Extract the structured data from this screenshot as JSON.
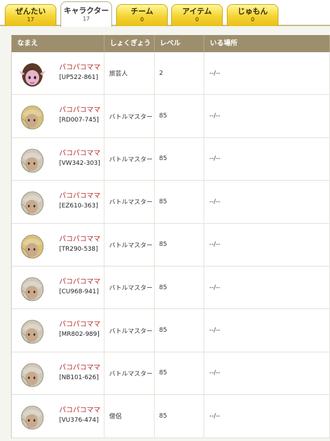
{
  "tabs": [
    {
      "label": "ぜんたい",
      "count": "17"
    },
    {
      "label": "キャラクター",
      "count": "17"
    },
    {
      "label": "チーム",
      "count": "0"
    },
    {
      "label": "アイテム",
      "count": "0"
    },
    {
      "label": "じゅもん",
      "count": "0"
    }
  ],
  "columns": {
    "name": "なまえ",
    "job": "しょくぎょう",
    "level": "レベル",
    "location": "いる場所"
  },
  "rows": [
    {
      "name": "パコパコママ",
      "id": "[UP522-861]",
      "job": "旅芸人",
      "level": "2",
      "location": "--/--",
      "avatar": "elf-dark-hair"
    },
    {
      "name": "パコパコママ",
      "id": "[RD007-745]",
      "job": "バトルマスター",
      "level": "85",
      "location": "--/--",
      "avatar": "blonde-hooded"
    },
    {
      "name": "パコパコママ",
      "id": "[VW342-303]",
      "job": "バトルマスター",
      "level": "85",
      "location": "--/--",
      "avatar": "silver-hooded"
    },
    {
      "name": "パコパコママ",
      "id": "[EZ610-363]",
      "job": "バトルマスター",
      "level": "85",
      "location": "--/--",
      "avatar": "silver-hooded"
    },
    {
      "name": "パコパコママ",
      "id": "[TR290-538]",
      "job": "バトルマスター",
      "level": "85",
      "location": "--/--",
      "avatar": "blonde-hooded"
    },
    {
      "name": "パコパコママ",
      "id": "[CU968-941]",
      "job": "バトルマスター",
      "level": "85",
      "location": "--/--",
      "avatar": "silver-hooded"
    },
    {
      "name": "パコパコママ",
      "id": "[MR802-989]",
      "job": "バトルマスター",
      "level": "85",
      "location": "--/--",
      "avatar": "silver-hooded"
    },
    {
      "name": "パコパコママ",
      "id": "[NB101-626]",
      "job": "バトルマスター",
      "level": "85",
      "location": "--/--",
      "avatar": "silver-hooded"
    },
    {
      "name": "パコパコママ",
      "id": "[VU376-474]",
      "job": "僧侶",
      "level": "85",
      "location": "--/--",
      "avatar": "silver-hooded"
    }
  ],
  "colors": {
    "tab_yellow": "#f4d431",
    "header_brown": "#9d8e6e",
    "name_red": "#b32a2a",
    "blonde": "#d9c07a",
    "silver": "#cfc8b8",
    "dark_hair": "#5a3a26",
    "elf_skin": "#e7b3cf"
  }
}
